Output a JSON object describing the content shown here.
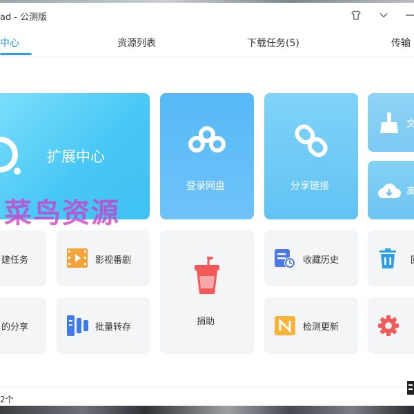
{
  "window": {
    "title": "ad - 公测版"
  },
  "tabs": [
    {
      "label": "中心",
      "active": true
    },
    {
      "label": "资源列表",
      "active": false
    },
    {
      "label": "下载任务(5)",
      "active": false
    },
    {
      "label": "传输",
      "active": false
    }
  ],
  "tiles": {
    "extension_center": "扩展中心",
    "login_cloud": "登录网盘",
    "share_link": "分享链接",
    "file_partial": "文",
    "cloud_partial": "离",
    "new_task": "建任务",
    "movies": "影视番剧",
    "donate": "捐助",
    "favorites_history": "收藏历史",
    "trash_partial": "回",
    "my_share": "的分享",
    "batch_save": "批量转存",
    "check_update": "检测更新"
  },
  "watermark": "菜鸟资源",
  "status_bar": {
    "text": "2个"
  },
  "colors": {
    "accent": "#2e9ee6",
    "tile_light": "#f4f5f7",
    "watermark": "#d03cc8"
  }
}
